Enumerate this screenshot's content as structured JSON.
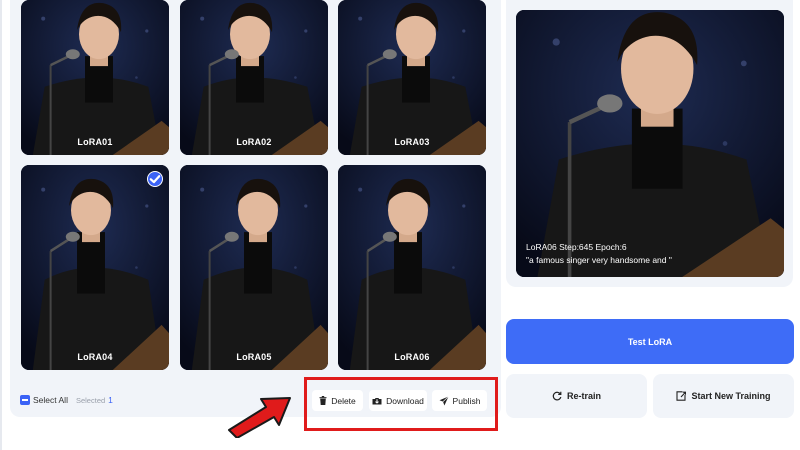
{
  "gallery": {
    "items": [
      {
        "label": "LoRA01",
        "selected": false
      },
      {
        "label": "LoRA02",
        "selected": false
      },
      {
        "label": "LoRA03",
        "selected": false
      },
      {
        "label": "LoRA04",
        "selected": true
      },
      {
        "label": "LoRA05",
        "selected": false
      },
      {
        "label": "LoRA06",
        "selected": false
      }
    ]
  },
  "selection": {
    "select_all_label": "Select All",
    "selected_label": "Selected",
    "selected_count": "1"
  },
  "actions": {
    "delete_label": "Delete",
    "download_label": "Download",
    "publish_label": "Publish"
  },
  "preview": {
    "caption_line1": "LoRA06 Step:645 Epoch:6",
    "caption_line2": "\"a famous singer very handsome and \""
  },
  "buttons": {
    "test_label": "Test LoRA",
    "retrain_label": "Re-train",
    "new_training_label": "Start New Training"
  },
  "colors": {
    "accent": "#3e6cf7",
    "highlight": "#e01b1b",
    "panel": "#f1f4f9"
  },
  "icons": [
    "check-icon",
    "trash-icon",
    "download-icon",
    "send-icon",
    "refresh-icon",
    "new-training-icon",
    "arrow-pointer"
  ]
}
